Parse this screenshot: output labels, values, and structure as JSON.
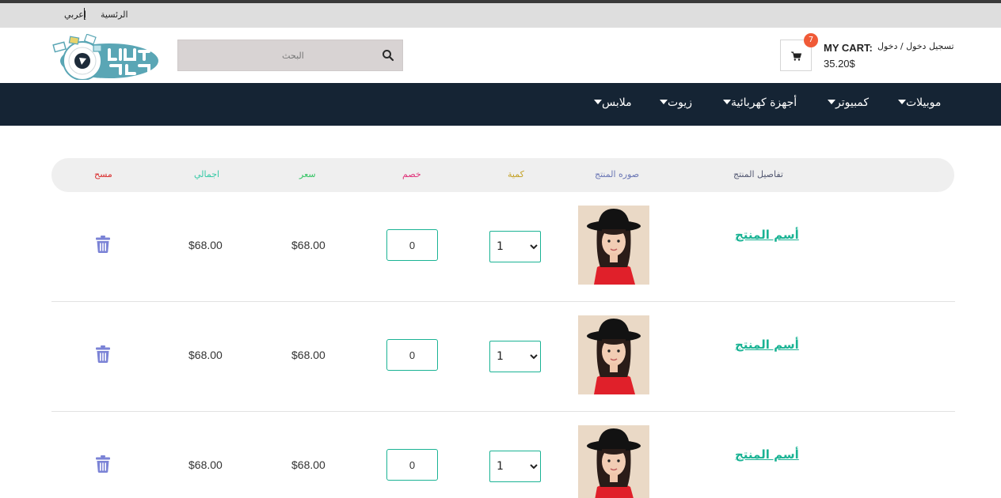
{
  "topbar": {
    "language": "إعربي",
    "home": "الرئسية"
  },
  "header": {
    "search_placeholder": "البحث",
    "login_links": "تسجيل دخول / دخول",
    "cart_label": "MY CART:",
    "cart_total": "35.20$",
    "cart_count": "7"
  },
  "nav": {
    "items": [
      "موبيلات",
      "كمبيوتر",
      "أجهزة كهربائية",
      "زيوت",
      "ملابس"
    ]
  },
  "table": {
    "headers": {
      "details": "تفاصيل المنتج",
      "image": "صوره المنتج",
      "quantity": "كمية",
      "discount": "خصم",
      "price": "سعر",
      "total": "اجمالي",
      "delete": "مسح"
    },
    "header_colors": {
      "details": "#555a73",
      "image": "#6b77b5",
      "quantity": "#c4a227",
      "discount": "#e0337a",
      "price": "#33c463",
      "total": "#33c9a5",
      "delete": "#d92b2b"
    },
    "rows": [
      {
        "name": "أسم المنتج",
        "quantity": "1",
        "discount": "0",
        "price": "$68.00",
        "total": "$68.00"
      },
      {
        "name": "أسم المنتج",
        "quantity": "1",
        "discount": "0",
        "price": "$68.00",
        "total": "$68.00"
      },
      {
        "name": "أسم المنتج",
        "quantity": "1",
        "discount": "0",
        "price": "$68.00",
        "total": "$68.00"
      }
    ]
  },
  "colors": {
    "accent": "#1ab394",
    "nav_bg": "#152434",
    "badge": "#f05a37",
    "trash": "#7b83d6"
  }
}
